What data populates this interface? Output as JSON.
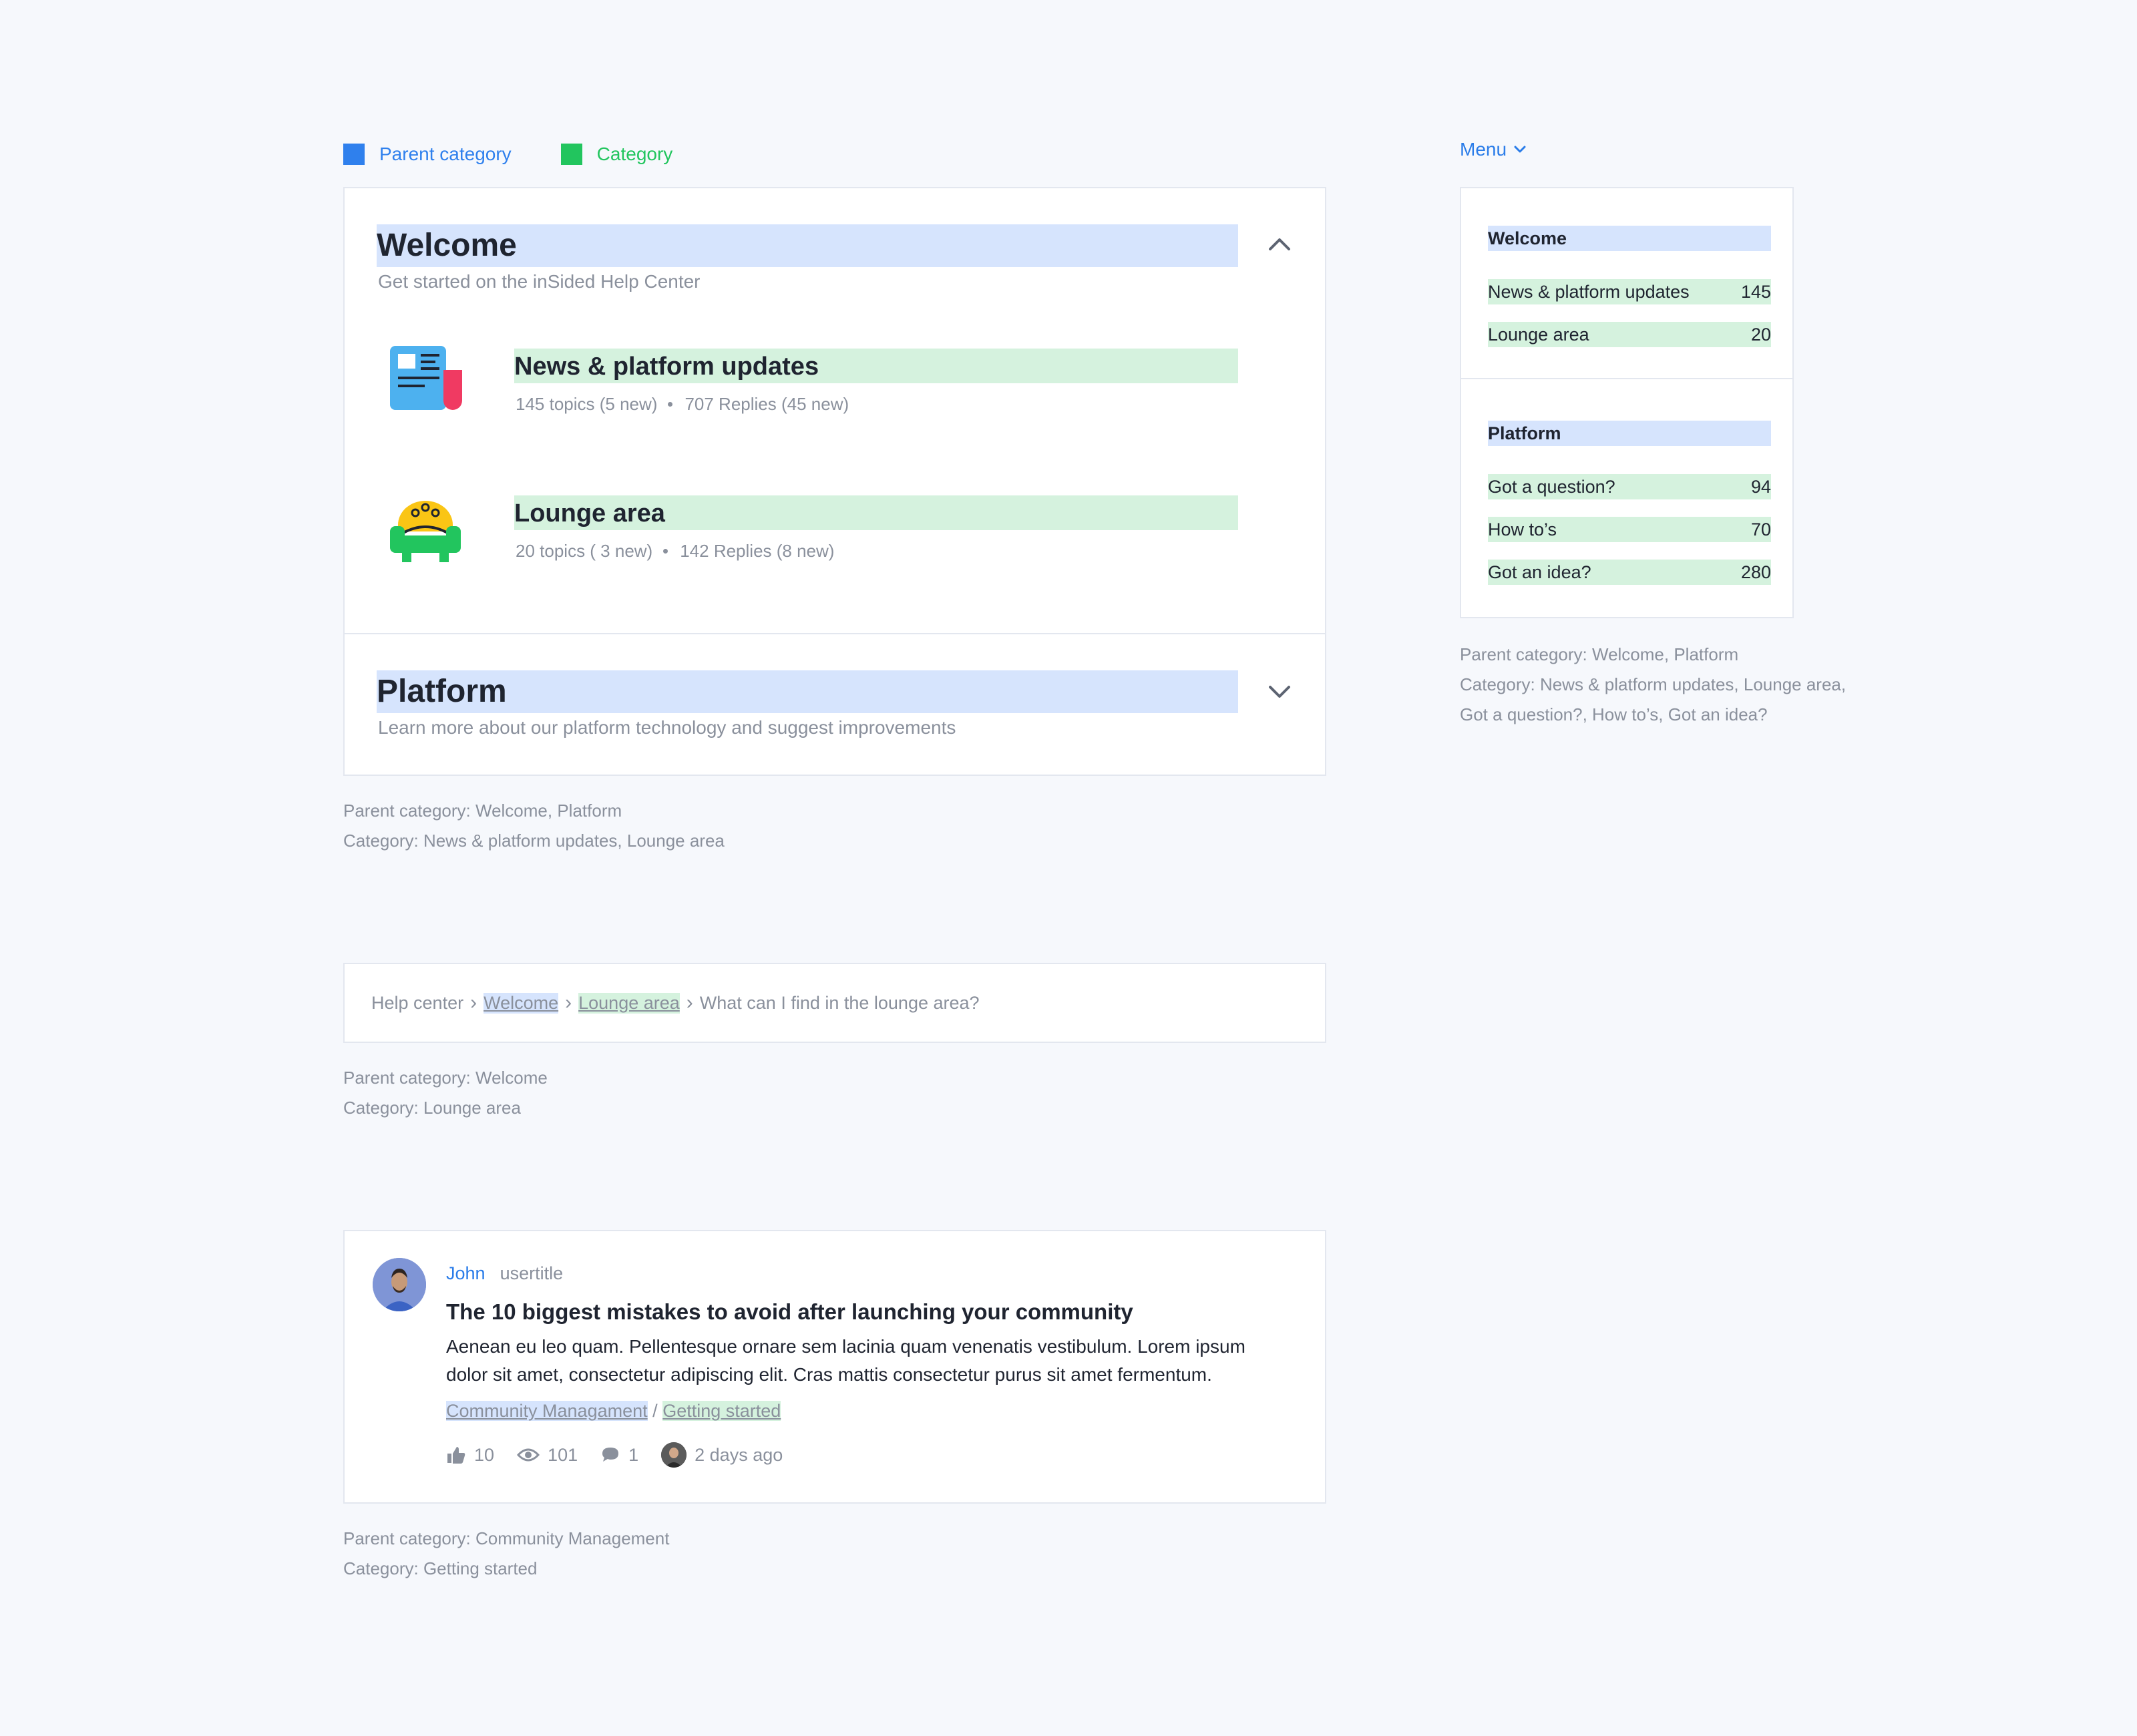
{
  "legend": {
    "parent": {
      "label": "Parent category",
      "color": "#2f80ed"
    },
    "category": {
      "label": "Category",
      "color": "#22c55e"
    }
  },
  "overview": {
    "sections": [
      {
        "title": "Welcome",
        "description": "Get started on the inSided Help Center",
        "expanded": true,
        "children": [
          {
            "title": "News & platform updates",
            "topics": "145 topics (5 new)",
            "replies": "707 Replies (45 new)",
            "icon": "newspaper-icon"
          },
          {
            "title": "Lounge area",
            "topics": "20 topics ( 3 new)",
            "replies": "142 Replies (8 new)",
            "icon": "armchair-icon"
          }
        ]
      },
      {
        "title": "Platform",
        "description": "Learn more about our platform technology and suggest improvements",
        "expanded": false
      }
    ],
    "note_parent": "Parent category: Welcome, Platform",
    "note_category": "Category: News & platform updates, Lounge area"
  },
  "breadcrumb": {
    "items": [
      "Help center",
      "Welcome",
      "Lounge area",
      "What can I find in the lounge area?"
    ],
    "note_parent": "Parent category: Welcome",
    "note_category": "Category: Lounge area"
  },
  "post": {
    "author": "John",
    "usertitle": "usertitle",
    "title": "The 10 biggest mistakes to avoid after launching your community",
    "body": "Aenean eu leo quam. Pellentesque ornare sem lacinia quam venenatis vestibulum. Lorem ipsum dolor sit amet, consectetur adipiscing elit. Cras mattis consectetur purus sit amet fermentum.",
    "parent_tag": "Community Managament",
    "tag_separator": "/",
    "category_tag": "Getting started",
    "likes": "10",
    "views": "101",
    "comments": "1",
    "time": "2 days ago",
    "note_parent": "Parent category: Community Management",
    "note_category": "Category: Getting started"
  },
  "menu": {
    "label": "Menu",
    "sections": [
      {
        "title": "Welcome",
        "items": [
          {
            "label": "News & platform updates",
            "count": "145"
          },
          {
            "label": "Lounge area",
            "count": "20"
          }
        ]
      },
      {
        "title": "Platform",
        "items": [
          {
            "label": "Got a question?",
            "count": "94"
          },
          {
            "label": "How to’s",
            "count": "70"
          },
          {
            "label": "Got an idea?",
            "count": "280"
          }
        ]
      }
    ],
    "note_parent": "Parent category: Welcome, Platform",
    "note_category_line1": "Category: News & platform updates, Lounge area,",
    "note_category_line2": "Got a question?, How to’s, Got an idea?"
  }
}
